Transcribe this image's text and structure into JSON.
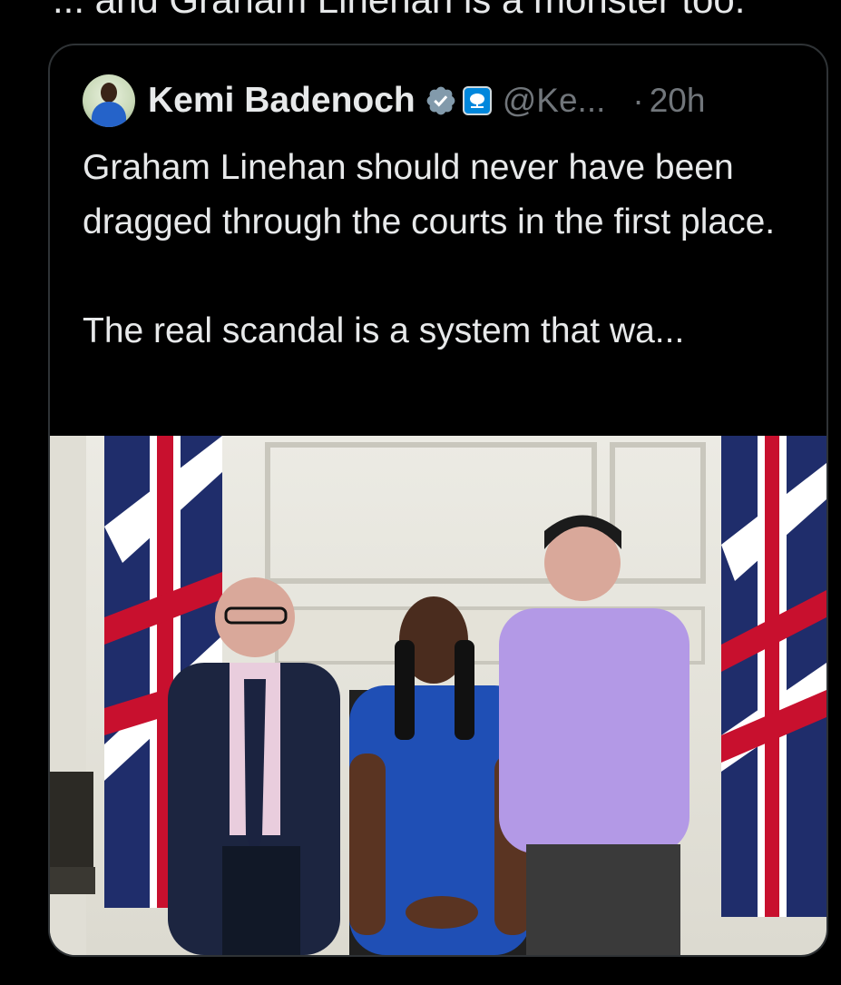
{
  "parent_tweet": {
    "text_fragment": "... and Graham Linehan is a monster too."
  },
  "quoted_tweet": {
    "author_name": "Kemi Badenoch",
    "handle": "@Ke...",
    "separator": "·",
    "time": "20h",
    "text": "Graham Linehan should never have been dragged through the courts in the first place.\n\nThe real scandal is a system that wa...",
    "verified": true,
    "affiliation_icon": "conservative-tree-icon",
    "avatar_icon": "profile-avatar",
    "image_description_icon": "photo"
  },
  "colors": {
    "background": "#000000",
    "text_primary": "#e7e9ea",
    "text_secondary": "#71767b",
    "border": "#2f3336",
    "verified_badge": "#829aab",
    "affiliation_badge": "#0087dc"
  }
}
